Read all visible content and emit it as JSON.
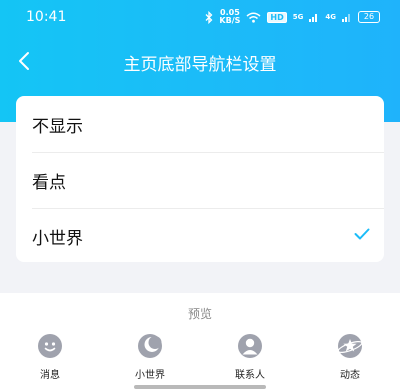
{
  "status_bar": {
    "time": "10:41",
    "speed_value": "0.05",
    "speed_unit": "KB/S",
    "hd": "HD",
    "signal_1": "5G",
    "signal_2": "4G",
    "battery": "26"
  },
  "nav": {
    "title": "主页底部导航栏设置"
  },
  "options": [
    {
      "label": "不显示"
    },
    {
      "label": "看点"
    },
    {
      "label": "小世界"
    }
  ],
  "accent_color": "#1bbcf8",
  "preview": {
    "label": "预览",
    "tabs": [
      {
        "label": "消息",
        "icon": "message-icon"
      },
      {
        "label": "小世界",
        "icon": "moon-icon"
      },
      {
        "label": "联系人",
        "icon": "contact-icon"
      },
      {
        "label": "动态",
        "icon": "planet-icon"
      }
    ]
  }
}
